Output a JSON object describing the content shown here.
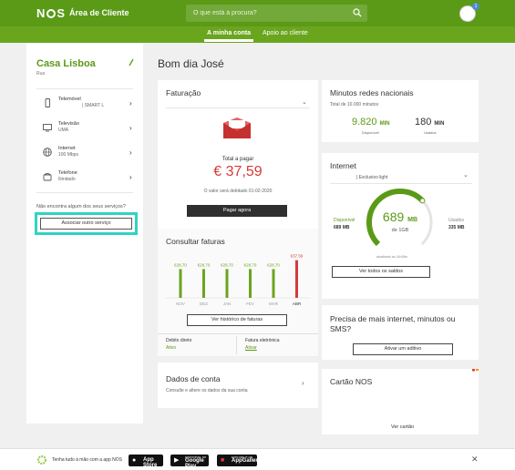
{
  "header": {
    "logo": "NOS",
    "app_title": "Área de Cliente",
    "search_placeholder": "O que está à procura?",
    "notification_count": "1"
  },
  "tabs": [
    {
      "label": "A minha conta",
      "active": true
    },
    {
      "label": "Apoio ao cliente",
      "active": false
    }
  ],
  "sidebar": {
    "title": "Casa Lisboa",
    "subtitle": "Rua",
    "services": [
      {
        "name": "Telemóvel",
        "detail": "| SMART L",
        "icon": "mobile-icon"
      },
      {
        "name": "Televisão",
        "detail": "UMA",
        "icon": "tv-icon"
      },
      {
        "name": "Internet",
        "detail": "100 Mbps",
        "icon": "globe-icon"
      },
      {
        "name": "Telefone",
        "detail": "Ilimitado",
        "icon": "phone-icon"
      }
    ],
    "question": "Não encontra algum dos seus serviços?",
    "associate_button": "Associar outro serviço"
  },
  "greeting": "Bom dia José",
  "faturacao": {
    "title": "Faturação",
    "total_label": "Total a pagar",
    "amount": "€ 37,59",
    "debit_note": "O valor será debitado 01-02-2020",
    "pay_button": "Pagar agora"
  },
  "consultar": {
    "title": "Consultar faturas",
    "history_button": "Ver histórico de faturas",
    "payment_label": "Debito direto",
    "payment_value": "Ativo",
    "einvoice_label": "Fatura eletrónica",
    "einvoice_value": "Ativar"
  },
  "chart_data": {
    "type": "bar",
    "categories": [
      "NOV",
      "DEZ",
      "JAN",
      "FEV",
      "MAR",
      "ABR"
    ],
    "values": [
      28.7,
      28.7,
      28.7,
      28.7,
      28.7,
      37.59
    ],
    "value_labels": [
      "€28,70",
      "€28,70",
      "€28,70",
      "€28,70",
      "€28,70",
      "€37,59"
    ],
    "colors": [
      "#6aa51e",
      "#6aa51e",
      "#6aa51e",
      "#6aa51e",
      "#6aa51e",
      "#d43b3b"
    ],
    "ylim": [
      0,
      40
    ]
  },
  "dados": {
    "title": "Dados de conta",
    "subtitle": "Consulte e altere os dados da sua conta"
  },
  "minutos": {
    "title": "Minutos redes nacionais",
    "subtitle": "Total de 10.000 minutos",
    "available_value": "9.820",
    "available_unit": "MIN",
    "available_label": "Disponível",
    "used_value": "180",
    "used_unit": "MIN",
    "used_label": "Usados"
  },
  "internet": {
    "title": "Internet",
    "plan": "| Exclusivo light",
    "used_fraction": 0.33,
    "center_value": "689",
    "center_unit": "MB",
    "of_total": "de 1GB",
    "available_label": "Disponível",
    "available_value": "689 MB",
    "used_label": "Usados",
    "used_value": "335 MB",
    "updated": "atualizado às 14h18m",
    "button": "Ver todos os saldos",
    "accent": "#5a9a17"
  },
  "precisa": {
    "title": "Precisa de mais internet, minutos ou SMS?",
    "button": "Ativar um aditivo"
  },
  "cartao": {
    "title": "Cartão NOS",
    "link": "Ver cartão"
  },
  "bottom": {
    "text": "Tenha tudo à mão com a app NOS",
    "stores": [
      {
        "small": "",
        "big": "App Store",
        "icon": "apple-icon"
      },
      {
        "small": "DISPONÍVEL NO",
        "big": "Google Play",
        "icon": "play-icon"
      },
      {
        "small": "EXPLORE IT ON",
        "big": "AppGallery",
        "icon": "appgallery-icon"
      }
    ]
  }
}
